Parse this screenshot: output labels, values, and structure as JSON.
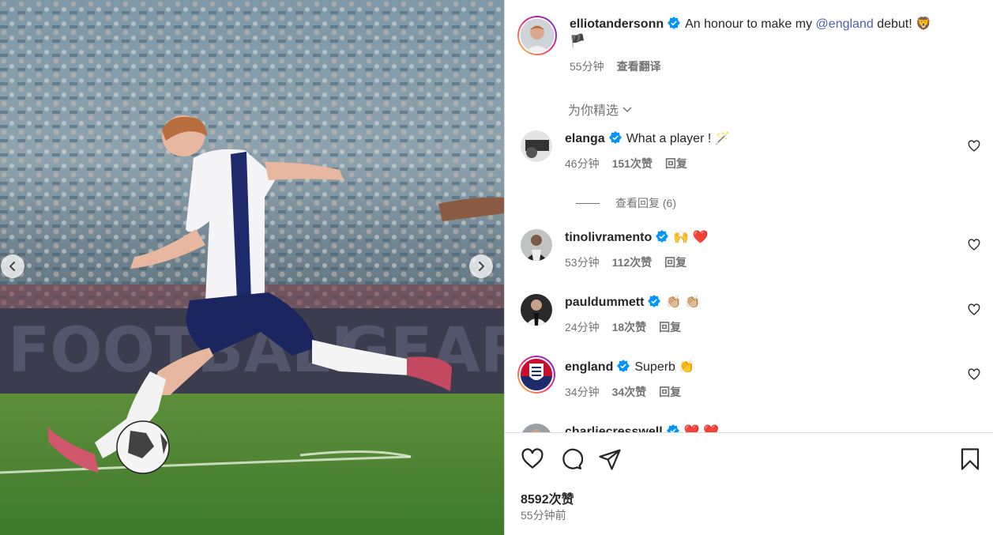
{
  "post": {
    "author": "elliotandersonn",
    "caption_text": "An honour to make my",
    "caption_mention": "@england",
    "caption_tail": "debut!",
    "caption_emoji": "🦁",
    "caption_flag": "🏴",
    "time": "55分钟",
    "translate": "查看翻译"
  },
  "picked_label": "为你精选",
  "comments": [
    {
      "user": "elanga",
      "text": "What a player !",
      "emoji": "🪄",
      "time": "46分钟",
      "likes": "151次赞",
      "reply": "回复",
      "view_replies": "查看回复 (6)"
    },
    {
      "user": "tinolivramento",
      "text": "",
      "emoji": "🙌 ❤️",
      "time": "53分钟",
      "likes": "112次赞",
      "reply": "回复"
    },
    {
      "user": "pauldummett",
      "text": "",
      "emoji": "👏🏼 👏🏼",
      "time": "24分钟",
      "likes": "18次赞",
      "reply": "回复"
    },
    {
      "user": "england",
      "text": "Superb",
      "emoji": "👏",
      "time": "34分钟",
      "likes": "34次赞",
      "reply": "回复"
    },
    {
      "user": "charliecresswell",
      "text": "",
      "emoji": "❤️ ❤️"
    }
  ],
  "footer": {
    "likes": "8592次赞",
    "time_ago": "55分钟前"
  },
  "colors": {
    "verified": "#0095f6",
    "mention": "#4a5fb5",
    "muted": "#737373"
  }
}
